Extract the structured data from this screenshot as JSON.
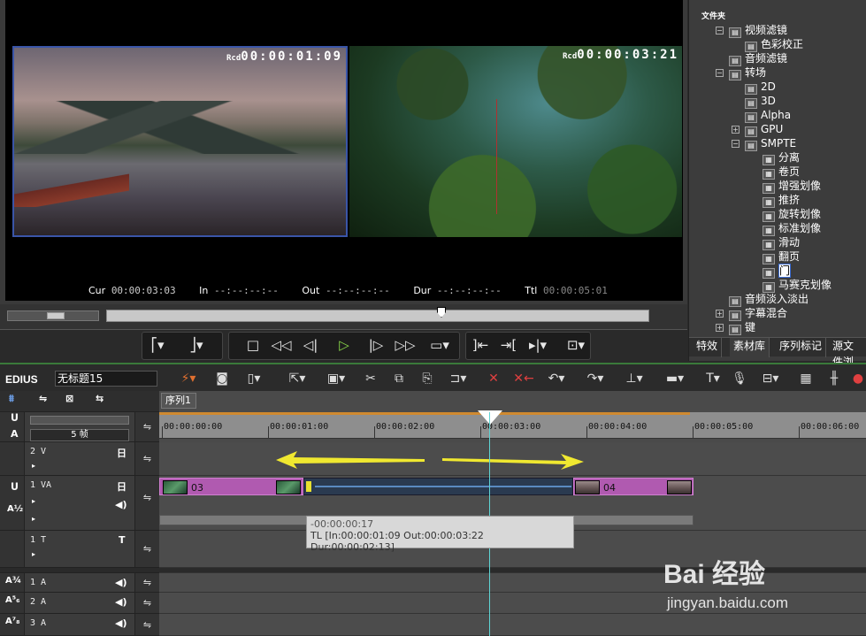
{
  "monitor": {
    "left_rec_label": "Rcd",
    "left_timecode": "00:00:01:09",
    "right_rec_label": "Rcd",
    "right_timecode": "00:00:03:21",
    "cur_label": "Cur",
    "cur_value": "00:00:03:03",
    "in_label": "In",
    "in_value": "--:--:--:--",
    "out_label": "Out",
    "out_value": "--:--:--:--",
    "dur_label": "Dur",
    "dur_value": "--:--:--:--",
    "ttl_label": "Ttl",
    "ttl_value": "00:00:05:01"
  },
  "effects_panel": {
    "title": "文件夹",
    "tree": [
      {
        "label": "视频滤镜",
        "level": 1,
        "expander": "⊟"
      },
      {
        "label": "色彩校正",
        "level": 2,
        "expander": ""
      },
      {
        "label": "音频滤镜",
        "level": 1,
        "expander": ""
      },
      {
        "label": "转场",
        "level": 1,
        "expander": "⊟"
      },
      {
        "label": "2D",
        "level": 2,
        "expander": ""
      },
      {
        "label": "3D",
        "level": 2,
        "expander": ""
      },
      {
        "label": "Alpha",
        "level": 2,
        "expander": ""
      },
      {
        "label": "GPU",
        "level": 2,
        "expander": "⊞"
      },
      {
        "label": "SMPTE",
        "level": 2,
        "expander": "⊟"
      },
      {
        "label": "分离",
        "level": 3,
        "expander": ""
      },
      {
        "label": "卷页",
        "level": 3,
        "expander": ""
      },
      {
        "label": "增强划像",
        "level": 3,
        "expander": ""
      },
      {
        "label": "推挤",
        "level": 3,
        "expander": ""
      },
      {
        "label": "旋转划像",
        "level": 3,
        "expander": ""
      },
      {
        "label": "标准划像",
        "level": 3,
        "expander": ""
      },
      {
        "label": "滑动",
        "level": 3,
        "expander": ""
      },
      {
        "label": "翻页",
        "level": 3,
        "expander": ""
      },
      {
        "label": "门",
        "level": 3,
        "expander": "",
        "selected": true
      },
      {
        "label": "马赛克划像",
        "level": 3,
        "expander": ""
      },
      {
        "label": "音频淡入淡出",
        "level": 1,
        "expander": ""
      },
      {
        "label": "字幕混合",
        "level": 1,
        "expander": "⊞"
      },
      {
        "label": "键",
        "level": 1,
        "expander": "⊞"
      }
    ],
    "tabs": [
      "特效",
      "素材库",
      "序列标记",
      "源文件浏"
    ]
  },
  "timeline": {
    "app_name": "EDIUS",
    "project_name": "无标题15",
    "sequence_tab": "序列1",
    "zoom_label": "5 帧",
    "ruler_ticks": [
      "00:00:00:00",
      "00:00:01:00",
      "00:00:02:00",
      "00:00:03:00",
      "00:00:04:00",
      "00:00:05:00",
      "00:00:06:00"
    ],
    "tracks": [
      {
        "name": "2 V"
      },
      {
        "name": "1 VA"
      },
      {
        "name": "1 T"
      },
      {
        "name": "1 A"
      },
      {
        "name": "2 A"
      },
      {
        "name": "3 A"
      }
    ],
    "clip_a_label": "03",
    "clip_b_label": "04",
    "tooltip_line1": "-00:00:00:17",
    "tooltip_line2": "TL [In:00:00:01:09 Out:00:00:03:22 Dur:00:00:02:13]"
  },
  "watermark": {
    "main": "Bai 经验",
    "sub": "jingyan.baidu.com"
  }
}
